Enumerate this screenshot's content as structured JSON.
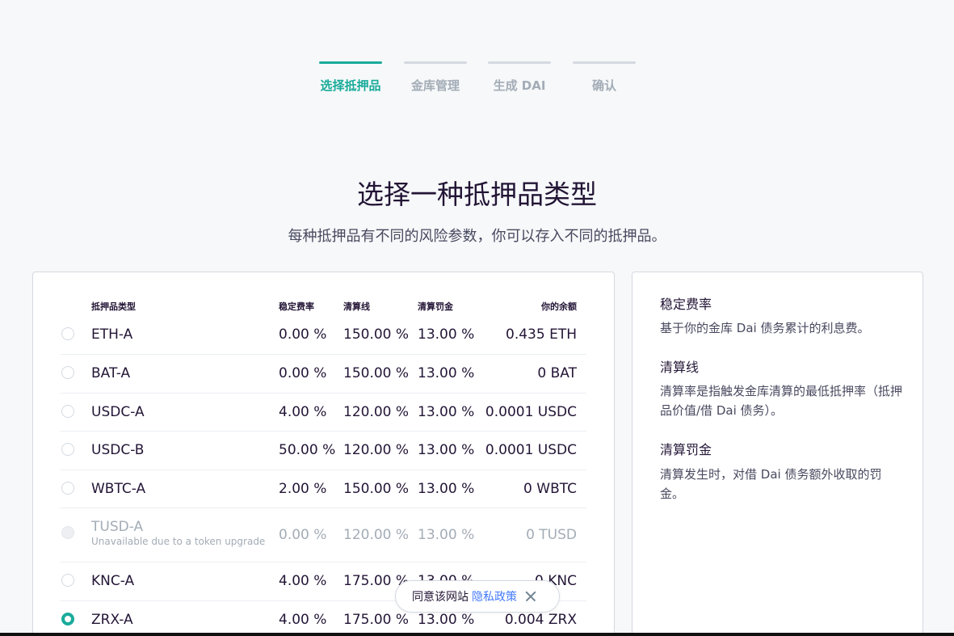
{
  "stepper": {
    "steps": [
      {
        "label": "选择抵押品",
        "active": true
      },
      {
        "label": "金库管理",
        "active": false
      },
      {
        "label": "生成 DAI",
        "active": false
      },
      {
        "label": "确认",
        "active": false
      }
    ]
  },
  "header": {
    "title": "选择一种抵押品类型",
    "subtitle": "每种抵押品有不同的风险参数，你可以存入不同的抵押品。"
  },
  "table": {
    "columns": {
      "type": "抵押品类型",
      "fee": "稳定费率",
      "liq_ratio": "清算线",
      "liq_penalty": "清算罚金",
      "balance": "你的余额"
    },
    "rows": [
      {
        "type": "ETH-A",
        "fee": "0.00 %",
        "liq_ratio": "150.00 %",
        "liq_penalty": "13.00 %",
        "balance": "0.435 ETH",
        "note": "",
        "disabled": false,
        "selected": false
      },
      {
        "type": "BAT-A",
        "fee": "0.00 %",
        "liq_ratio": "150.00 %",
        "liq_penalty": "13.00 %",
        "balance": "0 BAT",
        "note": "",
        "disabled": false,
        "selected": false
      },
      {
        "type": "USDC-A",
        "fee": "4.00 %",
        "liq_ratio": "120.00 %",
        "liq_penalty": "13.00 %",
        "balance": "0.0001 USDC",
        "note": "",
        "disabled": false,
        "selected": false
      },
      {
        "type": "USDC-B",
        "fee": "50.00 %",
        "liq_ratio": "120.00 %",
        "liq_penalty": "13.00 %",
        "balance": "0.0001 USDC",
        "note": "",
        "disabled": false,
        "selected": false
      },
      {
        "type": "WBTC-A",
        "fee": "2.00 %",
        "liq_ratio": "150.00 %",
        "liq_penalty": "13.00 %",
        "balance": "0 WBTC",
        "note": "",
        "disabled": false,
        "selected": false
      },
      {
        "type": "TUSD-A",
        "fee": "0.00 %",
        "liq_ratio": "120.00 %",
        "liq_penalty": "13.00 %",
        "balance": "0 TUSD",
        "note": "Unavailable due to a token upgrade",
        "disabled": true,
        "selected": false
      },
      {
        "type": "KNC-A",
        "fee": "4.00 %",
        "liq_ratio": "175.00 %",
        "liq_penalty": "13.00 %",
        "balance": "0 KNC",
        "note": "",
        "disabled": false,
        "selected": false
      },
      {
        "type": "ZRX-A",
        "fee": "4.00 %",
        "liq_ratio": "175.00 %",
        "liq_penalty": "13.00 %",
        "balance": "0.004 ZRX",
        "note": "",
        "disabled": false,
        "selected": true
      }
    ]
  },
  "info": {
    "items": [
      {
        "title": "稳定费率",
        "text": "基于你的金库 Dai 债务累计的利息费。"
      },
      {
        "title": "清算线",
        "text": "清算率是指触发金库清算的最低抵押率（抵押品价值/借 Dai 债务）。"
      },
      {
        "title": "清算罚金",
        "text": "清算发生时，对借 Dai 债务额外收取的罚金。"
      }
    ]
  },
  "cookie": {
    "text": "同意该网站",
    "link": "隐私政策"
  },
  "colors": {
    "accent": "#1aab9b",
    "link": "#447afb",
    "muted": "#a3acb6"
  }
}
